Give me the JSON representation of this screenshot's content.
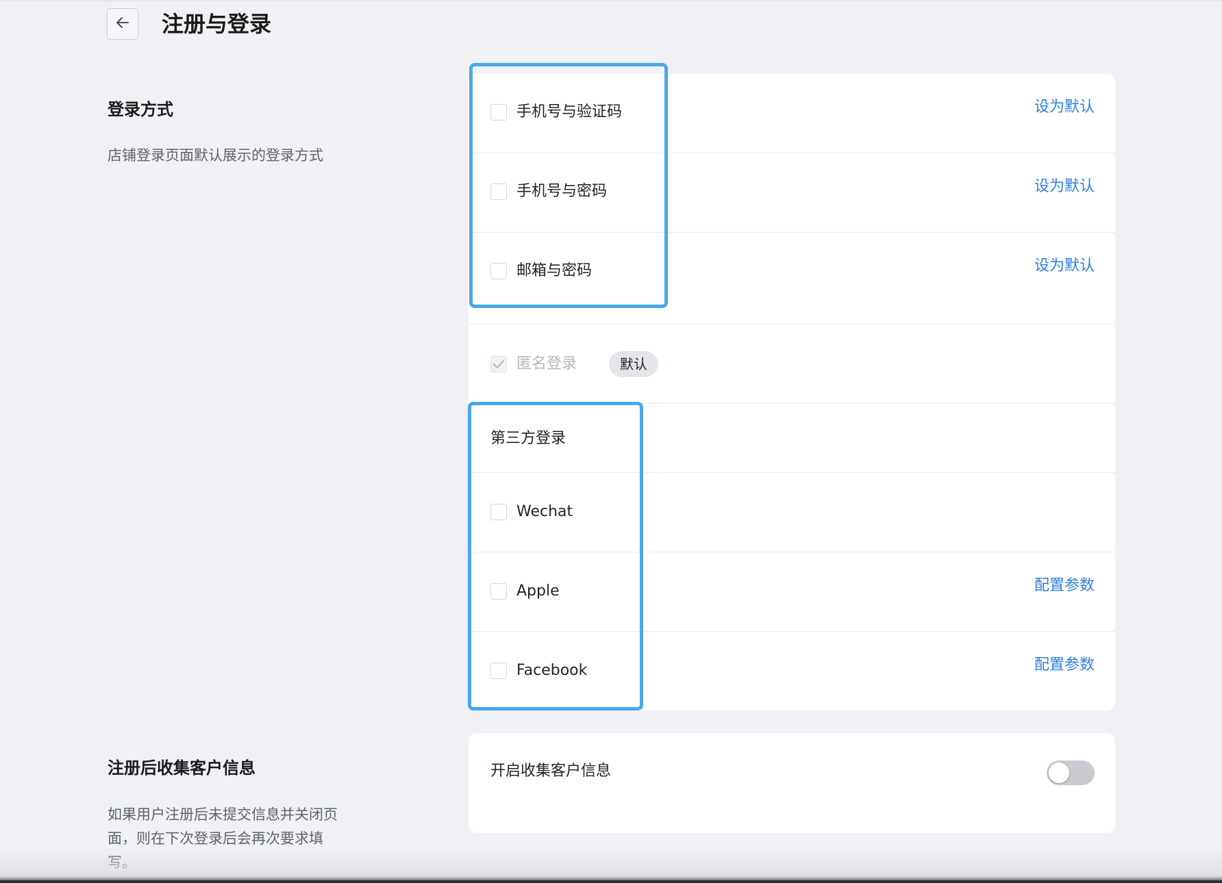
{
  "header": {
    "title": "注册与登录"
  },
  "login_section": {
    "title": "登录方式",
    "description": "店铺登录页面默认展示的登录方式",
    "methods": [
      {
        "label": "手机号与验证码",
        "action": "设为默认",
        "checked": false
      },
      {
        "label": "手机号与密码",
        "action": "设为默认",
        "checked": false
      },
      {
        "label": "邮箱与密码",
        "action": "设为默认",
        "checked": false
      }
    ],
    "anonymous": {
      "label": "匿名登录",
      "badge": "默认",
      "checked": true,
      "disabled": true
    },
    "third_party": {
      "heading": "第三方登录",
      "providers": [
        {
          "label": "Wechat",
          "action": "",
          "checked": false
        },
        {
          "label": "Apple",
          "action": "配置参数",
          "checked": false
        },
        {
          "label": "Facebook",
          "action": "配置参数",
          "checked": false
        }
      ]
    }
  },
  "collect_section": {
    "title": "注册后收集客户信息",
    "description": "如果用户注册后未提交信息并关闭页面，则在下次登录后会再次要求填写。",
    "toggle_label": "开启收集客户信息",
    "toggle_on": false
  },
  "colors": {
    "accent_link": "#2f7fe0",
    "highlight_box": "#4aa8e8",
    "background": "#f0f1f4"
  }
}
